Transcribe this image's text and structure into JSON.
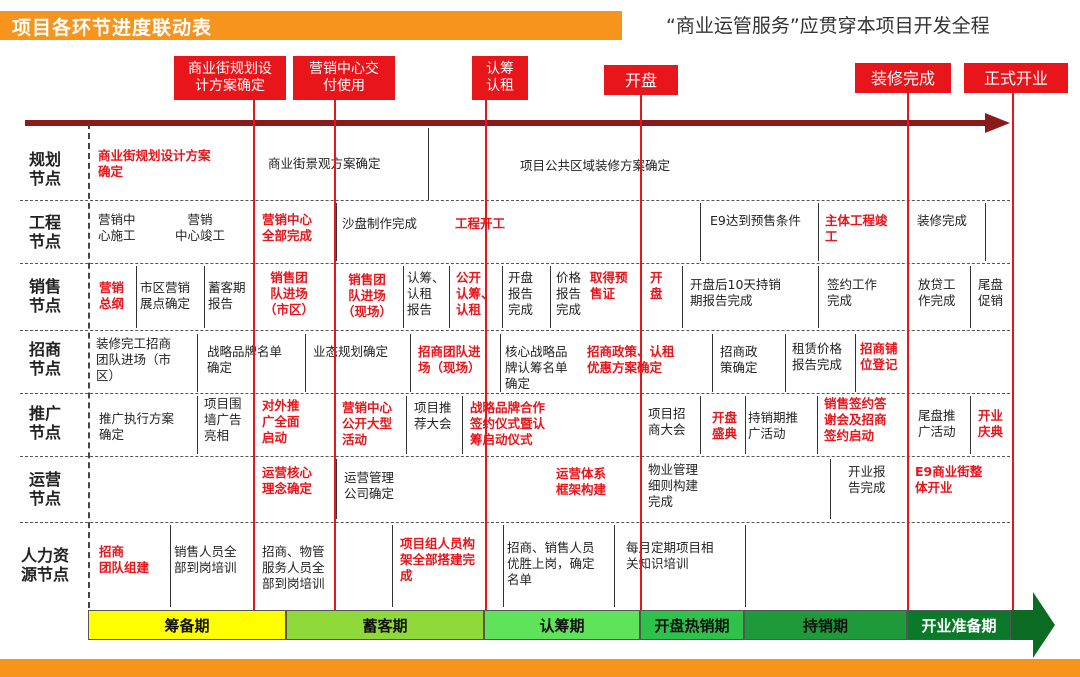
{
  "header": {
    "title": "项目各环节进度联动表",
    "slogan": "“商业运管服务”应贯穿本项目开发全程"
  },
  "milestones": [
    {
      "label": "商业街规划设\n计方案确定"
    },
    {
      "label": "营销中心交\n付使用"
    },
    {
      "label": "认筹\n认租"
    },
    {
      "label": "开盘"
    },
    {
      "label": "装修完成"
    },
    {
      "label": "正式开业"
    }
  ],
  "rows": [
    {
      "label": "规划\n节点"
    },
    {
      "label": "工程\n节点"
    },
    {
      "label": "销售\n节点"
    },
    {
      "label": "招商\n节点"
    },
    {
      "label": "推广\n节点"
    },
    {
      "label": "运营\n节点"
    },
    {
      "label": "人力资\n源节点"
    }
  ],
  "cells": {
    "planning": [
      "商业街规划设计方案\n确定",
      "商业街景观方案确定",
      "项目公共区域装修方案确定"
    ],
    "engineering": [
      "营销中\n心施工",
      "营销\n中心竣工",
      "营销中心\n全部完成",
      "沙盘制作完成",
      "工程开工",
      "E9达到预售条件",
      "主体工程竣\n工",
      "装修完成"
    ],
    "sales": [
      "营销\n总纲",
      "市区营销\n展点确定",
      "蓄客期\n报告",
      "销售团\n队进场\n（市区）",
      "销售团\n队进场\n（现场）",
      "认筹、\n认租\n报告",
      "公开\n认筹、\n认租",
      "开盘\n报告\n完成",
      "价格\n报告\n完成",
      "取得预\n售证",
      "开\n盘",
      "开盘后10天持销\n期报告完成",
      "签约工作\n完成",
      "放贷工\n作完成",
      "尾盘\n促销"
    ],
    "leasing": [
      "装修完工招商\n团队进场（市\n区）",
      "战略品牌名单\n确定",
      "业态规划确定",
      "招商团队进\n场（现场）",
      "核心战略品\n牌认筹名单\n确定",
      "招商政策、认租\n优惠方案确定",
      "招商政\n策确定",
      "租赁价格\n报告完成",
      "招商铺\n位登记"
    ],
    "promotion": [
      "推广执行方案\n确定",
      "项目围\n墙广告\n亮相",
      "对外推\n广全面\n启动",
      "营销中心\n公开大型\n活动",
      "项目推\n荐大会",
      "战略品牌合作\n签约仪式暨认\n筹启动仪式",
      "项目招\n商大会",
      "开盘\n盛典",
      "持销期推\n广活动",
      "销售签约答\n谢会及招商\n签约启动",
      "尾盘推\n广活动",
      "开业\n庆典"
    ],
    "operation": [
      "运营核心\n理念确定",
      "运营管理\n公司确定",
      "运营体系\n框架构建",
      "物业管理\n细则构建\n完成",
      "开业报\n告完成",
      "E9商业街整\n体开业"
    ],
    "hr": [
      "招商\n团队组建",
      "销售人员全\n部到岗培训",
      "招商、物管\n服务人员全\n部到岗培训",
      "项目组人员构\n架全部搭建完\n成",
      "招商、销售人员\n优胜上岗，确定\n名单",
      "每月定期项目相\n关知识培训"
    ]
  },
  "phases": [
    {
      "label": "筹备期",
      "color": "#ffff00"
    },
    {
      "label": "蓄客期",
      "color": "#8fd93b"
    },
    {
      "label": "认筹期",
      "color": "#5fe35a"
    },
    {
      "label": "开盘热销期",
      "color": "#2ec24a"
    },
    {
      "label": "持销期",
      "color": "#1e9a3a"
    },
    {
      "label": "开业准备期",
      "color": "#0a7a2a"
    }
  ],
  "colors": {
    "accent": "#e8151b",
    "header": "#f7941d",
    "arrow": "#8b1a1a",
    "end_arrow": "#0b6b22"
  }
}
